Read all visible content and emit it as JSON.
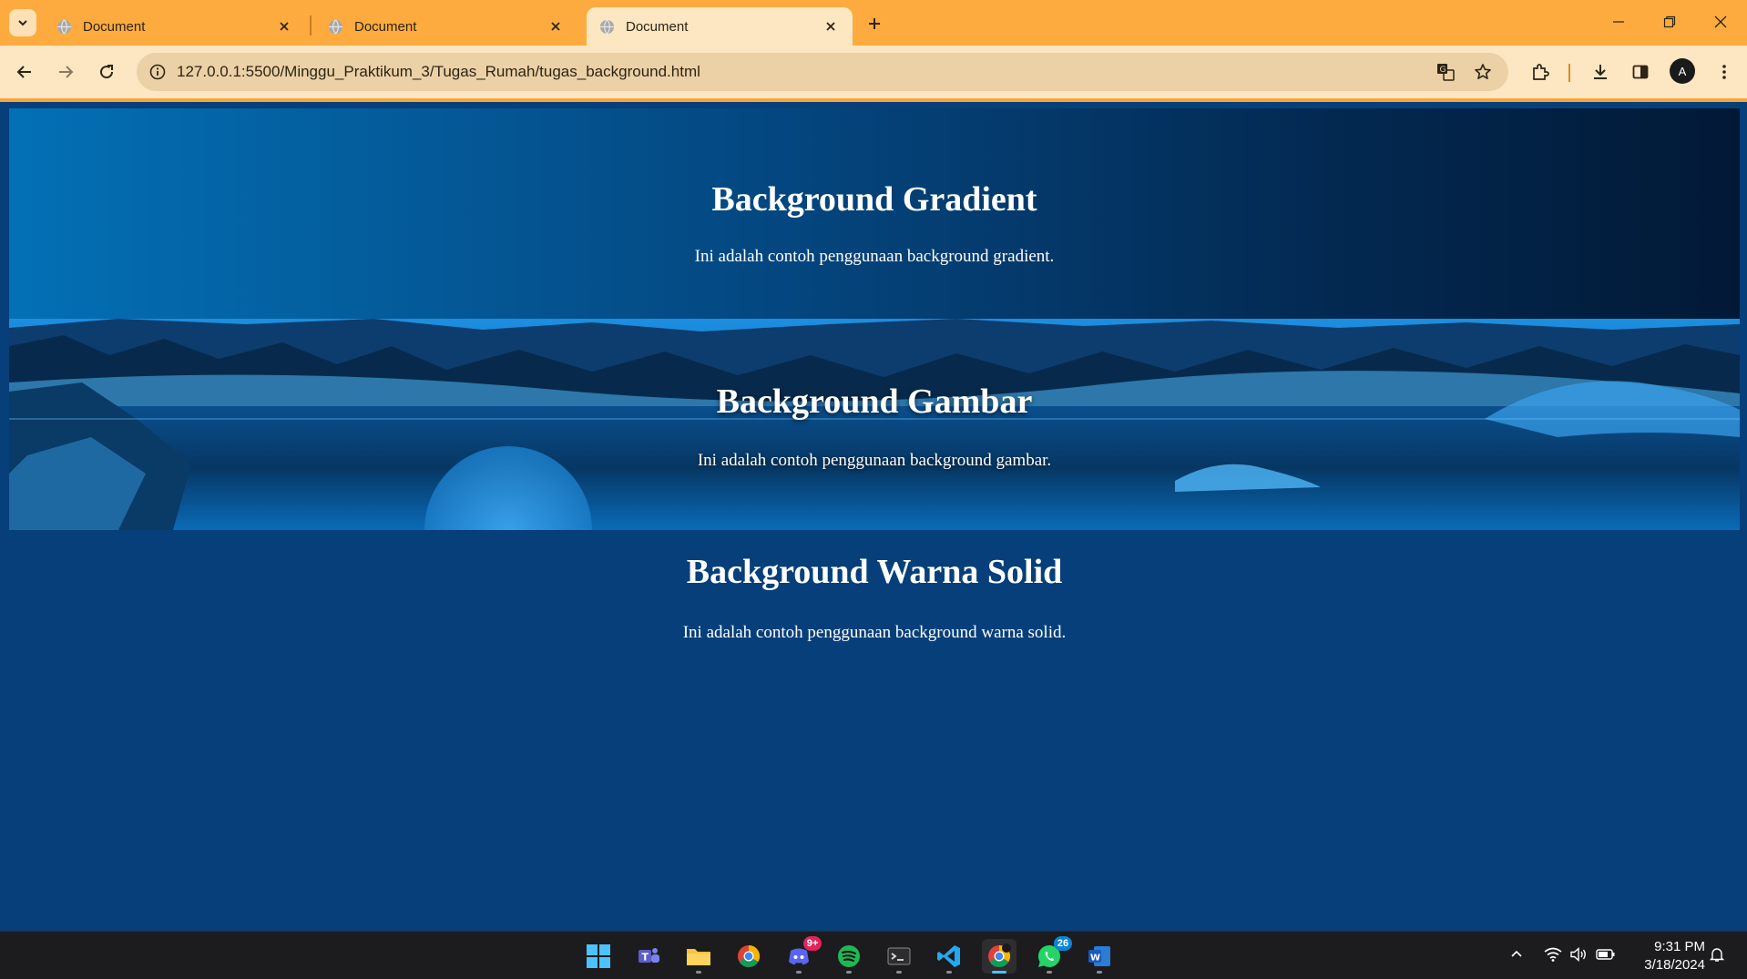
{
  "browser": {
    "tabs": [
      {
        "title": "Document",
        "active": false
      },
      {
        "title": "Document",
        "active": false
      },
      {
        "title": "Document",
        "active": true
      }
    ],
    "url": "127.0.0.1:5500/Minggu_Praktikum_3/Tugas_Rumah/tugas_background.html",
    "profile_initial": "A",
    "theme_color": "#fdab3f",
    "toolbar_color": "#fde6c2",
    "icons": [
      "tab-search-icon",
      "globe-icon",
      "close-icon",
      "plus-icon",
      "minimize-icon",
      "restore-icon",
      "back-icon",
      "forward-icon",
      "reload-icon",
      "info-icon",
      "translate-icon",
      "star-icon",
      "extensions-icon",
      "download-icon",
      "side-panel-icon",
      "kebab-menu-icon"
    ]
  },
  "page": {
    "sections": {
      "gradient": {
        "heading": "Background Gradient",
        "text": "Ini adalah contoh penggunaan background gradient.",
        "gradient_colors": [
          "#0370b5",
          "#04467f",
          "#021936"
        ]
      },
      "image": {
        "heading": "Background Gambar",
        "text": "Ini adalah contoh penggunaan background gambar."
      },
      "solid": {
        "heading": "Background Warna Solid",
        "text": "Ini adalah contoh penggunaan background warna solid.",
        "color": "#073f7a"
      }
    }
  },
  "taskbar": {
    "apps": [
      {
        "name": "start"
      },
      {
        "name": "teams"
      },
      {
        "name": "file-explorer"
      },
      {
        "name": "chrome"
      },
      {
        "name": "discord",
        "badge": "9+"
      },
      {
        "name": "spotify"
      },
      {
        "name": "terminal"
      },
      {
        "name": "vscode"
      },
      {
        "name": "chrome-profile",
        "active": true
      },
      {
        "name": "whatsapp",
        "badge": "26"
      },
      {
        "name": "word"
      }
    ],
    "clock": {
      "time": "9:31 PM",
      "date": "3/18/2024"
    }
  }
}
